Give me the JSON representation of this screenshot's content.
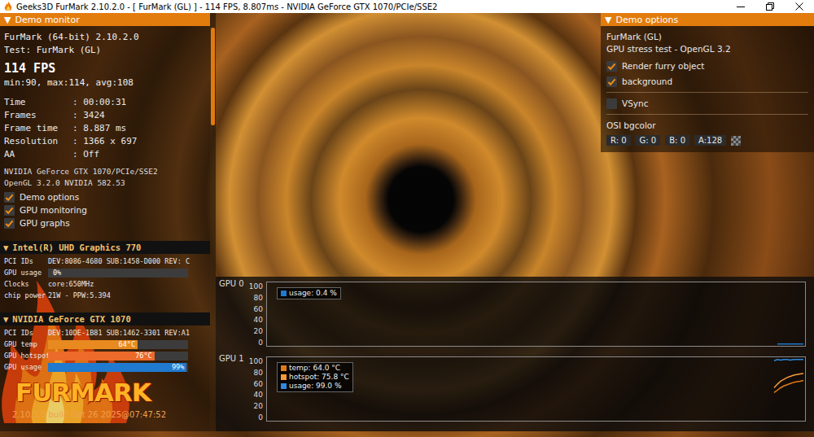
{
  "window": {
    "title": "Geeks3D FurMark 2.10.2.0 - [ FurMark (GL) ] - 114 FPS, 8.807ms - NVIDIA GeForce GTX 1070/PCIe/SSE2"
  },
  "monitor": {
    "header": {
      "arrow": "▼",
      "title": "Demo monitor"
    },
    "app": "FurMark (64-bit) 2.10.2.0",
    "test": "Test: FurMark (GL)",
    "fps": "114 FPS",
    "fps_stats": "min:90, max:114, avg:108",
    "stats": [
      {
        "label": "Time",
        "value": ": 00:00:31"
      },
      {
        "label": "Frames",
        "value": ": 3424"
      },
      {
        "label": "Frame time",
        "value": ": 8.887 ms"
      },
      {
        "label": "Resolution",
        "value": ": 1366 x 697"
      },
      {
        "label": "AA",
        "value": ": Off"
      }
    ],
    "renderer": "NVIDIA GeForce GTX 1070/PCIe/SSE2",
    "opengl": "OpenGL 3.2.0 NVIDIA 582.53",
    "toggles": [
      {
        "label": "Demo options",
        "checked": true
      },
      {
        "label": "GPU monitoring",
        "checked": true
      },
      {
        "label": "GPU graphs",
        "checked": true
      }
    ],
    "gpus": [
      {
        "arrow": "▼",
        "name": "Intel(R) UHD Graphics 770",
        "rows": [
          {
            "kind": "text",
            "label": "PCI IDs",
            "value": "DEV:8086-4680 SUB:1458-D000 REV: C"
          },
          {
            "kind": "bar",
            "label": "GPU usage",
            "reading": "0%",
            "level": 0,
            "color": "#1f7ad0"
          },
          {
            "kind": "text",
            "label": "Clocks",
            "value": "core:650MHz"
          },
          {
            "kind": "text",
            "label": "chip power",
            "value": "21W - PPW:5.394"
          }
        ]
      },
      {
        "arrow": "▼",
        "name": "NVIDIA GeForce GTX 1070",
        "rows": [
          {
            "kind": "text",
            "label": "PCI IDs",
            "value": "DEV:10DE-1B81 SUB:1462-3301 REV:A1"
          },
          {
            "kind": "bar",
            "label": "GPU temp",
            "reading": "64°C",
            "level": 0.64,
            "color": "#e88a20"
          },
          {
            "kind": "bar",
            "label": "GPU hotspot",
            "reading": "76°C",
            "level": 0.76,
            "color": "#ec6a2a"
          },
          {
            "kind": "bar",
            "label": "GPU usage",
            "reading": "99%",
            "level": 0.99,
            "color": "#1f7ad0"
          }
        ]
      }
    ],
    "logo": "FURMARK",
    "build": "2.10.2.0 build Oct 26 2025@07:47:52"
  },
  "options": {
    "header": {
      "arrow": "▼",
      "title": "Demo options"
    },
    "title": "FurMark (GL)",
    "subtitle": "GPU stress test - OpenGL 3.2",
    "toggle_groups": [
      [
        {
          "label": "Render furry object",
          "checked": true
        },
        {
          "label": "background",
          "checked": true
        }
      ],
      [
        {
          "label": "VSync",
          "checked": false
        }
      ]
    ],
    "bgcolor_label": "OSI bgcolor",
    "bgcolor": [
      "R: 0",
      "G: 0",
      "B: 0",
      "A:128"
    ]
  },
  "graphs": [
    {
      "label": "GPU 0",
      "ticks": [
        "100",
        "80",
        "60",
        "40",
        "20",
        "0"
      ],
      "series": [
        {
          "label": "usage: 0.4 %",
          "color": "#1f7ad0",
          "values": [
            0.4,
            0.4,
            0.4,
            0.4,
            0.4,
            0.4,
            0.4,
            0.4,
            0.4
          ]
        }
      ]
    },
    {
      "label": "GPU 1",
      "ticks": [
        "100",
        "80",
        "60",
        "40",
        "20",
        "0"
      ],
      "series": [
        {
          "label": "temp: 64.0 °C",
          "color": "#e07a18",
          "values": [
            44,
            48,
            52,
            55,
            57,
            59,
            61,
            62,
            63,
            64
          ]
        },
        {
          "label": "hotspot: 75.8 °C",
          "color": "#f59a3a",
          "values": [
            52,
            58,
            63,
            66,
            69,
            71,
            73,
            74,
            75,
            75.8
          ]
        },
        {
          "label": "usage: 99.0 %",
          "color": "#2f8ae0",
          "values": [
            97,
            99,
            98,
            99,
            99,
            98,
            99,
            99,
            99,
            99
          ]
        }
      ]
    }
  ]
}
